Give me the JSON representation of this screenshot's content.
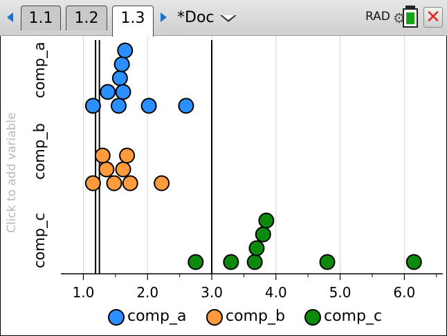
{
  "tabs": [
    {
      "label": "1.1",
      "active": false
    },
    {
      "label": "1.2",
      "active": false
    },
    {
      "label": "1.3",
      "active": true
    }
  ],
  "document_title": "*Doc",
  "angle_mode": "RAD",
  "icons": [
    "left-arrow-icon",
    "right-arrow-icon",
    "dropdown-caret-icon",
    "gear-icon",
    "battery-icon",
    "close-icon"
  ],
  "colors": {
    "comp_a": "#2b8fff",
    "comp_b": "#ff9b3d",
    "comp_c": "#0b8a0b"
  },
  "side_labels": {
    "comp_a": "comp_a",
    "comp_b": "comp_b",
    "comp_c": "comp_c",
    "add_variable": "Click to add variable"
  },
  "legend": [
    {
      "name": "comp_a",
      "color": "#2b8fff"
    },
    {
      "name": "comp_b",
      "color": "#ff9b3d"
    },
    {
      "name": "comp_c",
      "color": "#0b8a0b"
    }
  ],
  "chart_data": {
    "type": "scatter",
    "subtype": "dot_plot",
    "xlim": [
      0.65,
      6.6
    ],
    "xticks": [
      "1.0",
      "2.0",
      "3.0",
      "4.0",
      "5.0",
      "6.0"
    ],
    "xtick_values": [
      1.0,
      2.0,
      3.0,
      4.0,
      5.0,
      6.0
    ],
    "grid": true,
    "reference_lines": [
      1.19,
      1.25,
      3.0
    ],
    "legend_position": "bottom",
    "series": [
      {
        "name": "comp_a",
        "color": "#2b8fff",
        "values": [
          1.15,
          1.38,
          1.55,
          1.57,
          1.62,
          1.6,
          1.65,
          2.02,
          2.6
        ]
      },
      {
        "name": "comp_b",
        "color": "#ff9b3d",
        "values": [
          1.15,
          1.36,
          1.3,
          1.48,
          1.62,
          1.68,
          1.73,
          2.22
        ]
      },
      {
        "name": "comp_c",
        "color": "#0b8a0b",
        "values": [
          2.75,
          3.3,
          3.67,
          3.7,
          3.8,
          3.85,
          4.8,
          6.15
        ]
      }
    ]
  }
}
